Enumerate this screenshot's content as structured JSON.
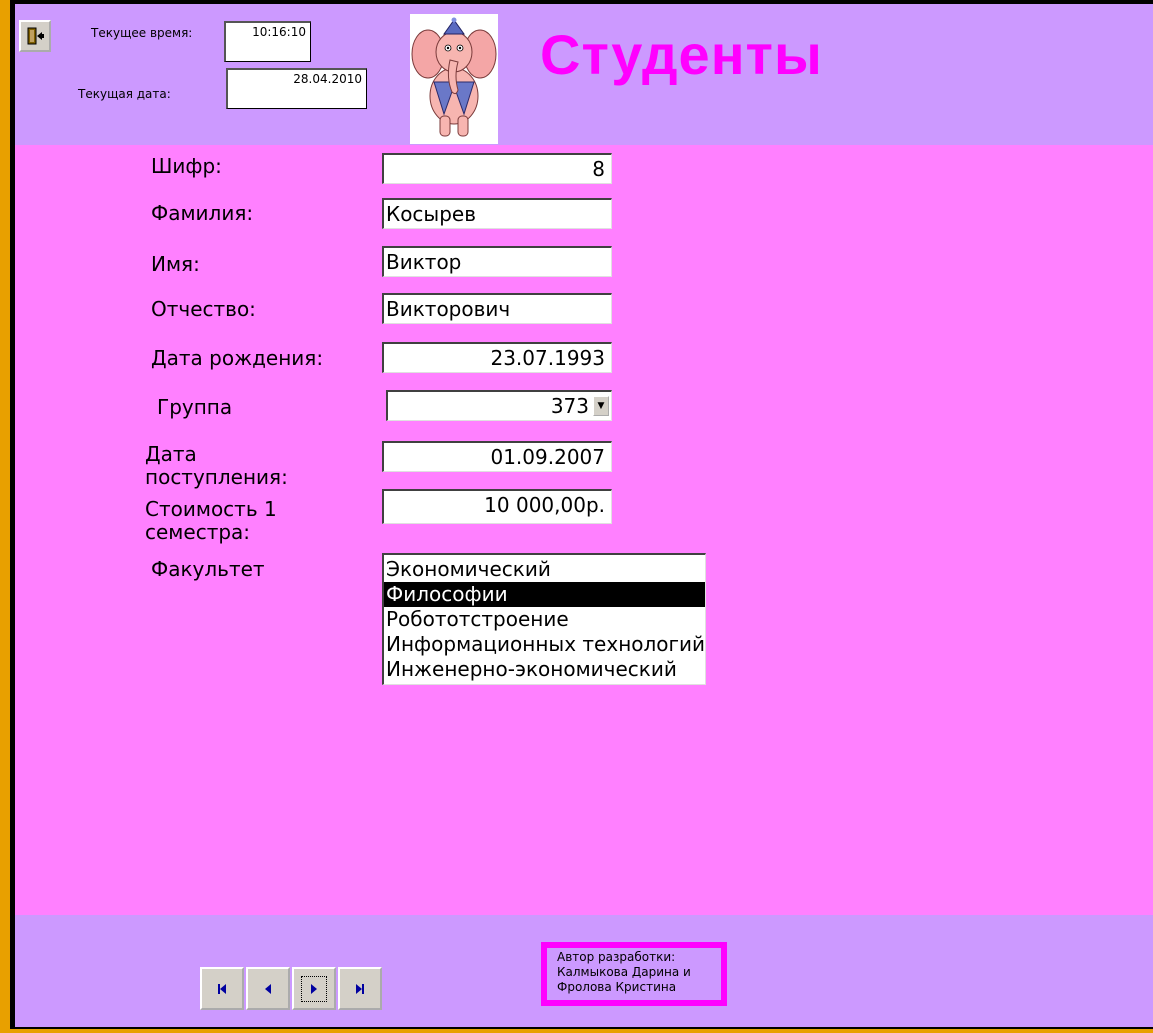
{
  "header": {
    "time_label": "Текущее время:",
    "time_value": "10:16:10",
    "date_label": "Текущая дата:",
    "date_value": "28.04.2010",
    "title": "Студенты"
  },
  "form": {
    "code_label": "Шифр:",
    "code_value": "8",
    "surname_label": "Фамилия:",
    "surname_value": "Косырев",
    "name_label": "Имя:",
    "name_value": "Виктор",
    "patronymic_label": "Отчество:",
    "patronymic_value": "Викторович",
    "birthdate_label": "Дата рождения:",
    "birthdate_value": "23.07.1993",
    "group_label": "Группа",
    "group_value": "373",
    "admission_label_1": "Дата",
    "admission_label_2": "поступления:",
    "admission_value": "01.09.2007",
    "cost_label_1": "Стоимость 1",
    "cost_label_2": "семестра:",
    "cost_value": "10 000,00р.",
    "faculty_label": "Факультет",
    "faculties": [
      "Экономический",
      "Философии",
      "Робототстроение",
      "Информационных технологий",
      "Инженерно-экономический"
    ],
    "selected_faculty_index": 1
  },
  "footer": {
    "credit_line1": "Автор разработки:",
    "credit_line2": "Калмыкова Дарина и",
    "credit_line3": "Фролова Кристина"
  },
  "colors": {
    "header_bg": "#CC99FF",
    "detail_bg": "#FF80FF",
    "title": "#FF00FF",
    "frame": "#E8A000"
  },
  "icons": {
    "exit": "exit-door-icon",
    "nav_first": "first-record-icon",
    "nav_prev": "previous-record-icon",
    "nav_next": "next-record-icon",
    "nav_last": "last-record-icon"
  }
}
